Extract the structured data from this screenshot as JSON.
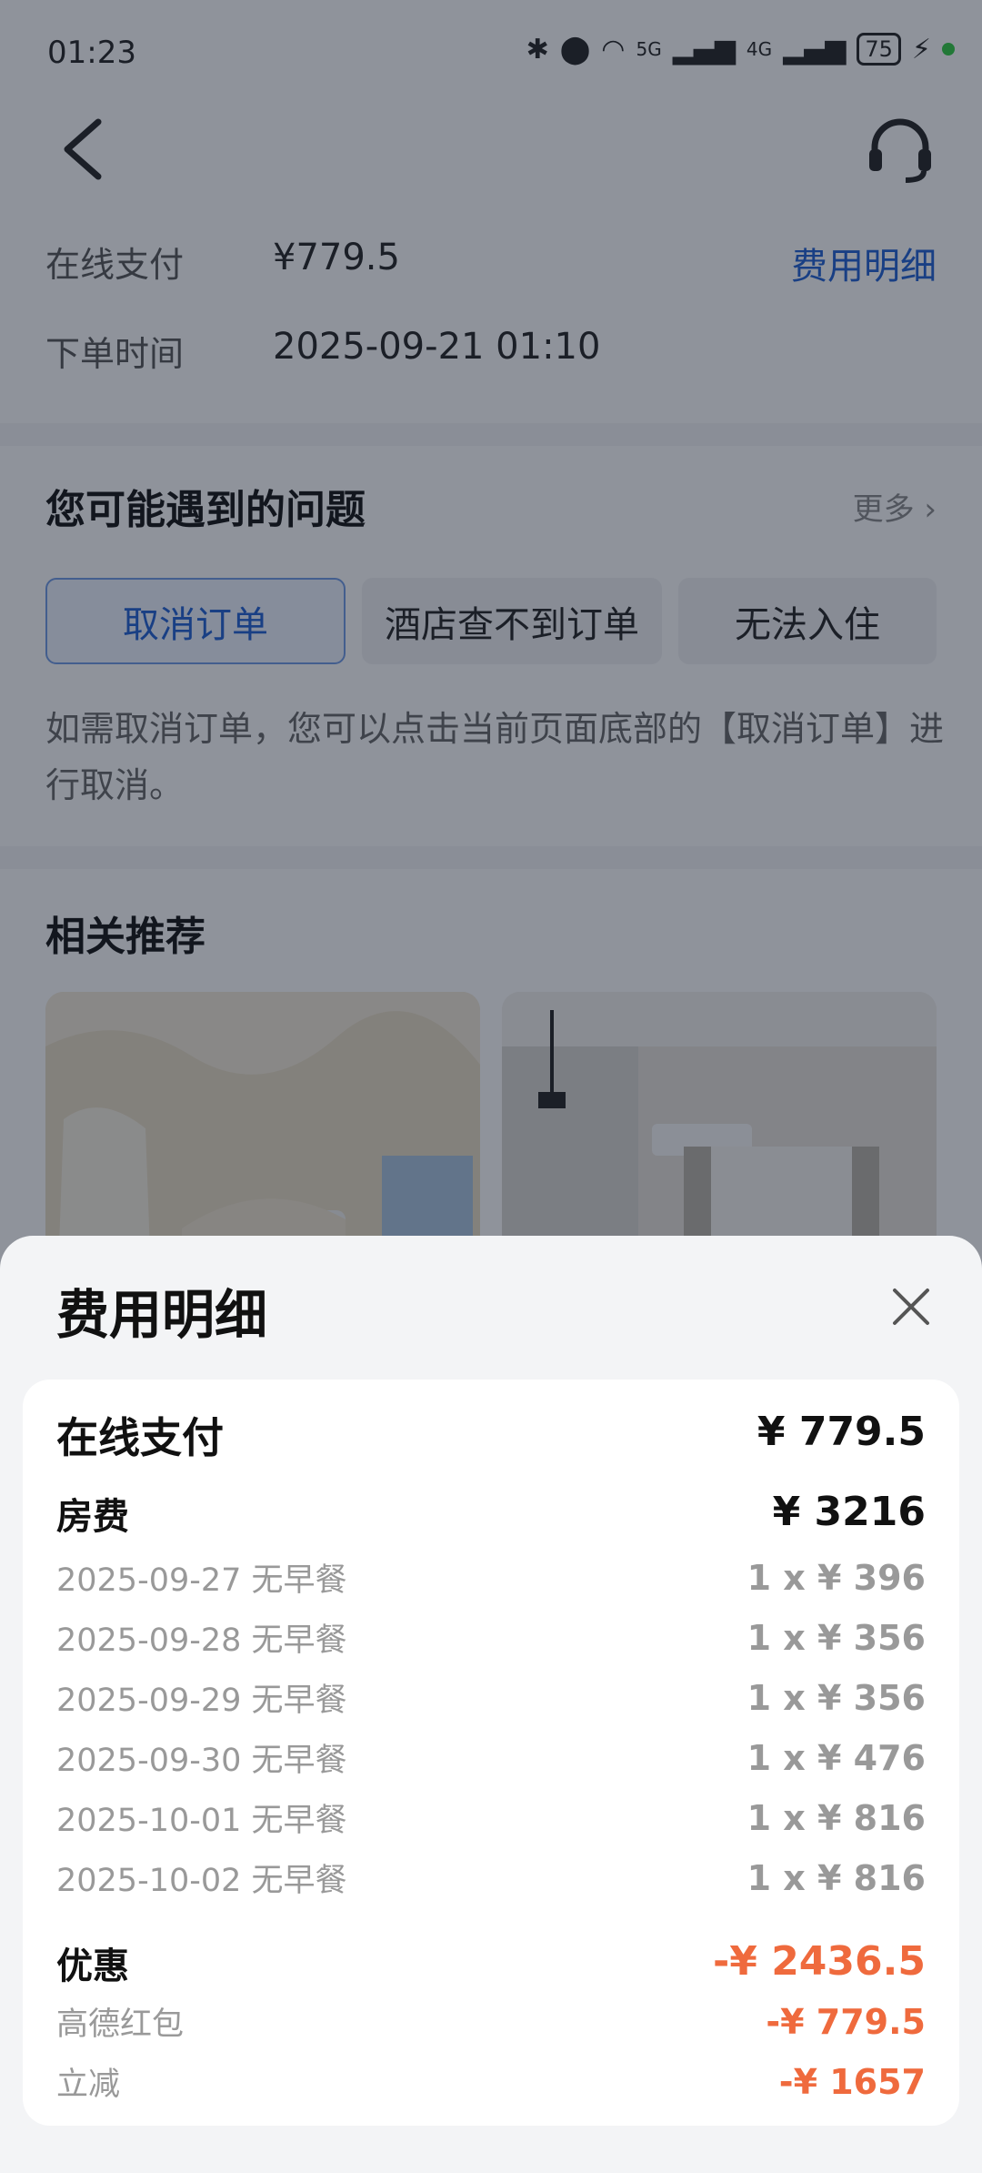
{
  "status": {
    "time": "01:23",
    "battery": "75",
    "signal1": "5G",
    "signal2": "4G"
  },
  "payment": {
    "label_online": "在线支付",
    "amount": "¥779.5",
    "fee_link": "费用明细",
    "label_time": "下单时间",
    "order_time": "2025-09-21 01:10"
  },
  "issues": {
    "title": "您可能遇到的问题",
    "more": "更多",
    "chips": [
      "取消订单",
      "酒店查不到订单",
      "无法入住"
    ],
    "description": "如需取消订单，您可以点击当前页面底部的【取消订单】进行取消。"
  },
  "recommend": {
    "title": "相关推荐"
  },
  "sheet": {
    "title": "费用明细",
    "online_label": "在线支付",
    "online_value": "¥ 779.5",
    "room_label": "房费",
    "room_value": "¥ 3216",
    "nights": [
      {
        "date": "2025-09-27 无早餐",
        "price": "1 x ¥ 396"
      },
      {
        "date": "2025-09-28 无早餐",
        "price": "1 x ¥ 356"
      },
      {
        "date": "2025-09-29 无早餐",
        "price": "1 x ¥ 356"
      },
      {
        "date": "2025-09-30 无早餐",
        "price": "1 x ¥ 476"
      },
      {
        "date": "2025-10-01 无早餐",
        "price": "1 x ¥ 816"
      },
      {
        "date": "2025-10-02 无早餐",
        "price": "1 x ¥ 816"
      }
    ],
    "discount_label": "优惠",
    "discount_value": "-¥ 2436.5",
    "discounts": [
      {
        "label": "高德红包",
        "value": "-¥ 779.5"
      },
      {
        "label": "立减",
        "value": "-¥ 1657"
      }
    ]
  },
  "colors": {
    "accent_blue": "#1d5fd3",
    "discount_red": "#ef6a3d"
  }
}
